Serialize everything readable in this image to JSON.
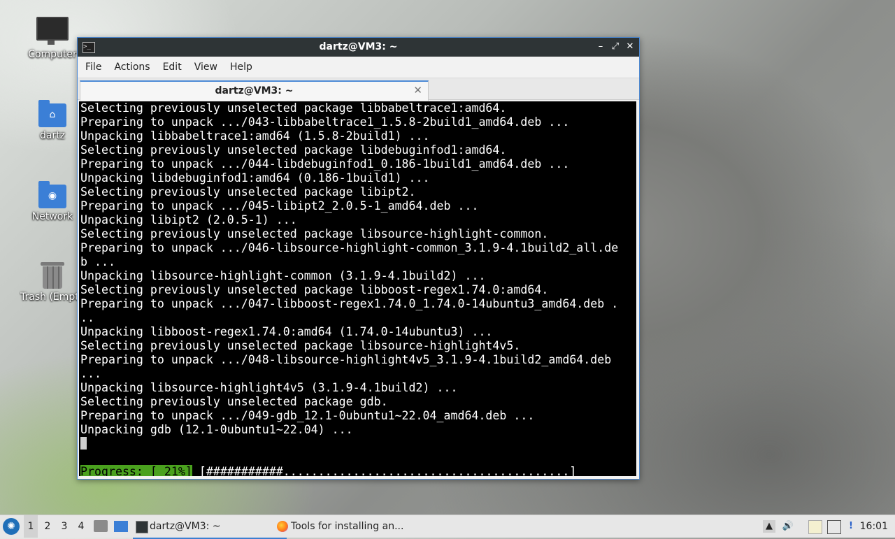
{
  "desktop": {
    "icons": [
      {
        "label": "Computer"
      },
      {
        "label": "dartz"
      },
      {
        "label": "Network"
      },
      {
        "label": "Trash (Empty)"
      }
    ]
  },
  "window": {
    "title": "dartz@VM3: ~",
    "menu": [
      "File",
      "Actions",
      "Edit",
      "View",
      "Help"
    ],
    "tab_label": "dartz@VM3: ~",
    "terminal_lines": [
      "Selecting previously unselected package libbabeltrace1:amd64.",
      "Preparing to unpack .../043-libbabeltrace1_1.5.8-2build1_amd64.deb ...",
      "Unpacking libbabeltrace1:amd64 (1.5.8-2build1) ...",
      "Selecting previously unselected package libdebuginfod1:amd64.",
      "Preparing to unpack .../044-libdebuginfod1_0.186-1build1_amd64.deb ...",
      "Unpacking libdebuginfod1:amd64 (0.186-1build1) ...",
      "Selecting previously unselected package libipt2.",
      "Preparing to unpack .../045-libipt2_2.0.5-1_amd64.deb ...",
      "Unpacking libipt2 (2.0.5-1) ...",
      "Selecting previously unselected package libsource-highlight-common.",
      "Preparing to unpack .../046-libsource-highlight-common_3.1.9-4.1build2_all.de",
      "b ...",
      "Unpacking libsource-highlight-common (3.1.9-4.1build2) ...",
      "Selecting previously unselected package libboost-regex1.74.0:amd64.",
      "Preparing to unpack .../047-libboost-regex1.74.0_1.74.0-14ubuntu3_amd64.deb .",
      "..",
      "Unpacking libboost-regex1.74.0:amd64 (1.74.0-14ubuntu3) ...",
      "Selecting previously unselected package libsource-highlight4v5.",
      "Preparing to unpack .../048-libsource-highlight4v5_3.1.9-4.1build2_amd64.deb",
      "...",
      "Unpacking libsource-highlight4v5 (3.1.9-4.1build2) ...",
      "Selecting previously unselected package gdb.",
      "Preparing to unpack .../049-gdb_12.1-0ubuntu1~22.04_amd64.deb ...",
      "Unpacking gdb (12.1-0ubuntu1~22.04) ..."
    ],
    "progress_label": "Progress: [ 21%]",
    "progress_bar": " [###########.........................................]",
    "progress_percent": 21
  },
  "taskbar": {
    "workspaces": [
      "1",
      "2",
      "3",
      "4"
    ],
    "tasks": [
      {
        "label": "dartz@VM3: ~"
      },
      {
        "label": "Tools for installing an..."
      }
    ],
    "clock": "16:01"
  }
}
